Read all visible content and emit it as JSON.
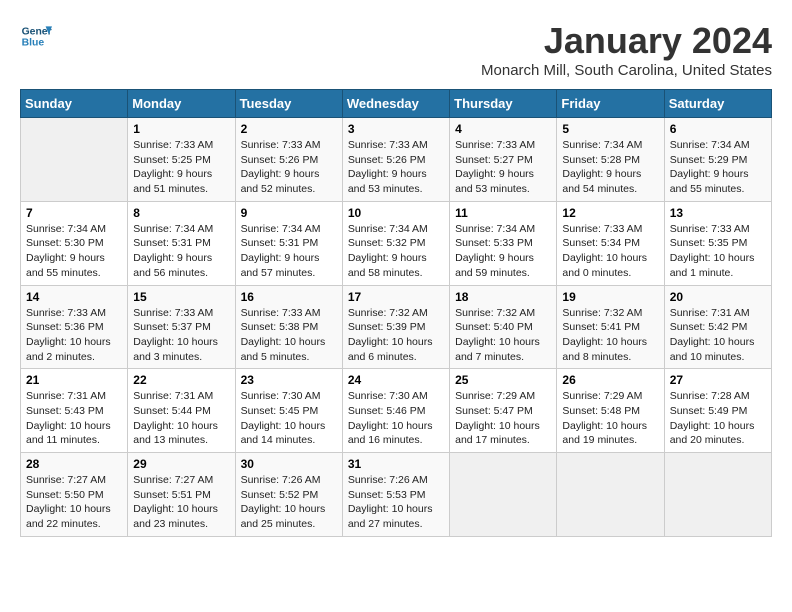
{
  "header": {
    "logo_line1": "General",
    "logo_line2": "Blue",
    "month_title": "January 2024",
    "location": "Monarch Mill, South Carolina, United States"
  },
  "weekdays": [
    "Sunday",
    "Monday",
    "Tuesday",
    "Wednesday",
    "Thursday",
    "Friday",
    "Saturday"
  ],
  "weeks": [
    [
      {
        "num": "",
        "info": ""
      },
      {
        "num": "1",
        "info": "Sunrise: 7:33 AM\nSunset: 5:25 PM\nDaylight: 9 hours\nand 51 minutes."
      },
      {
        "num": "2",
        "info": "Sunrise: 7:33 AM\nSunset: 5:26 PM\nDaylight: 9 hours\nand 52 minutes."
      },
      {
        "num": "3",
        "info": "Sunrise: 7:33 AM\nSunset: 5:26 PM\nDaylight: 9 hours\nand 53 minutes."
      },
      {
        "num": "4",
        "info": "Sunrise: 7:33 AM\nSunset: 5:27 PM\nDaylight: 9 hours\nand 53 minutes."
      },
      {
        "num": "5",
        "info": "Sunrise: 7:34 AM\nSunset: 5:28 PM\nDaylight: 9 hours\nand 54 minutes."
      },
      {
        "num": "6",
        "info": "Sunrise: 7:34 AM\nSunset: 5:29 PM\nDaylight: 9 hours\nand 55 minutes."
      }
    ],
    [
      {
        "num": "7",
        "info": "Sunrise: 7:34 AM\nSunset: 5:30 PM\nDaylight: 9 hours\nand 55 minutes."
      },
      {
        "num": "8",
        "info": "Sunrise: 7:34 AM\nSunset: 5:31 PM\nDaylight: 9 hours\nand 56 minutes."
      },
      {
        "num": "9",
        "info": "Sunrise: 7:34 AM\nSunset: 5:31 PM\nDaylight: 9 hours\nand 57 minutes."
      },
      {
        "num": "10",
        "info": "Sunrise: 7:34 AM\nSunset: 5:32 PM\nDaylight: 9 hours\nand 58 minutes."
      },
      {
        "num": "11",
        "info": "Sunrise: 7:34 AM\nSunset: 5:33 PM\nDaylight: 9 hours\nand 59 minutes."
      },
      {
        "num": "12",
        "info": "Sunrise: 7:33 AM\nSunset: 5:34 PM\nDaylight: 10 hours\nand 0 minutes."
      },
      {
        "num": "13",
        "info": "Sunrise: 7:33 AM\nSunset: 5:35 PM\nDaylight: 10 hours\nand 1 minute."
      }
    ],
    [
      {
        "num": "14",
        "info": "Sunrise: 7:33 AM\nSunset: 5:36 PM\nDaylight: 10 hours\nand 2 minutes."
      },
      {
        "num": "15",
        "info": "Sunrise: 7:33 AM\nSunset: 5:37 PM\nDaylight: 10 hours\nand 3 minutes."
      },
      {
        "num": "16",
        "info": "Sunrise: 7:33 AM\nSunset: 5:38 PM\nDaylight: 10 hours\nand 5 minutes."
      },
      {
        "num": "17",
        "info": "Sunrise: 7:32 AM\nSunset: 5:39 PM\nDaylight: 10 hours\nand 6 minutes."
      },
      {
        "num": "18",
        "info": "Sunrise: 7:32 AM\nSunset: 5:40 PM\nDaylight: 10 hours\nand 7 minutes."
      },
      {
        "num": "19",
        "info": "Sunrise: 7:32 AM\nSunset: 5:41 PM\nDaylight: 10 hours\nand 8 minutes."
      },
      {
        "num": "20",
        "info": "Sunrise: 7:31 AM\nSunset: 5:42 PM\nDaylight: 10 hours\nand 10 minutes."
      }
    ],
    [
      {
        "num": "21",
        "info": "Sunrise: 7:31 AM\nSunset: 5:43 PM\nDaylight: 10 hours\nand 11 minutes."
      },
      {
        "num": "22",
        "info": "Sunrise: 7:31 AM\nSunset: 5:44 PM\nDaylight: 10 hours\nand 13 minutes."
      },
      {
        "num": "23",
        "info": "Sunrise: 7:30 AM\nSunset: 5:45 PM\nDaylight: 10 hours\nand 14 minutes."
      },
      {
        "num": "24",
        "info": "Sunrise: 7:30 AM\nSunset: 5:46 PM\nDaylight: 10 hours\nand 16 minutes."
      },
      {
        "num": "25",
        "info": "Sunrise: 7:29 AM\nSunset: 5:47 PM\nDaylight: 10 hours\nand 17 minutes."
      },
      {
        "num": "26",
        "info": "Sunrise: 7:29 AM\nSunset: 5:48 PM\nDaylight: 10 hours\nand 19 minutes."
      },
      {
        "num": "27",
        "info": "Sunrise: 7:28 AM\nSunset: 5:49 PM\nDaylight: 10 hours\nand 20 minutes."
      }
    ],
    [
      {
        "num": "28",
        "info": "Sunrise: 7:27 AM\nSunset: 5:50 PM\nDaylight: 10 hours\nand 22 minutes."
      },
      {
        "num": "29",
        "info": "Sunrise: 7:27 AM\nSunset: 5:51 PM\nDaylight: 10 hours\nand 23 minutes."
      },
      {
        "num": "30",
        "info": "Sunrise: 7:26 AM\nSunset: 5:52 PM\nDaylight: 10 hours\nand 25 minutes."
      },
      {
        "num": "31",
        "info": "Sunrise: 7:26 AM\nSunset: 5:53 PM\nDaylight: 10 hours\nand 27 minutes."
      },
      {
        "num": "",
        "info": ""
      },
      {
        "num": "",
        "info": ""
      },
      {
        "num": "",
        "info": ""
      }
    ]
  ]
}
